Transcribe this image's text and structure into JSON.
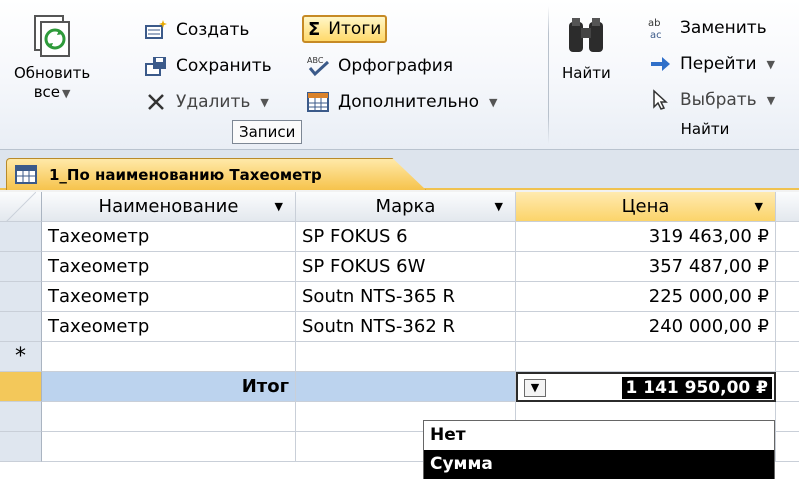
{
  "ribbon": {
    "refresh_label_line1": "Обновить",
    "refresh_label_line2": "все",
    "create_label": "Создать",
    "save_label": "Сохранить",
    "delete_label": "Удалить",
    "totals_label": "Итоги",
    "spelling_label": "Орфография",
    "more_label": "Дополнительно",
    "records_group_label": "Записи",
    "find_label": "Найти",
    "replace_label": "Заменить",
    "goto_label": "Перейти",
    "select_label": "Выбрать",
    "find_group_label": "Найти",
    "sigma_symbol": "Σ"
  },
  "tab": {
    "title": "1_По наименованию Тахеометр"
  },
  "table": {
    "columns": [
      "Наименование",
      "Марка",
      "Цена"
    ],
    "rows": [
      [
        "Тахеометр",
        "SP FOKUS 6",
        "319 463,00 ₽"
      ],
      [
        "Тахеометр",
        "SP FOKUS 6W",
        "357 487,00 ₽"
      ],
      [
        "Тахеометр",
        "Soutn NTS-365 R",
        "225 000,00 ₽"
      ],
      [
        "Тахеометр",
        "Soutn NTS-362 R",
        "240 000,00 ₽"
      ]
    ],
    "new_row_marker": "*",
    "totals_label": "Итог",
    "totals_value": "1 141 950,00 ₽"
  },
  "totals_dropdown": {
    "options": [
      "Нет",
      "Сумма"
    ],
    "selected": "Сумма"
  },
  "colors": {
    "accent": "#f6c34c",
    "totals_row": "#bcd3ee",
    "header_active": "#fbd46a"
  }
}
